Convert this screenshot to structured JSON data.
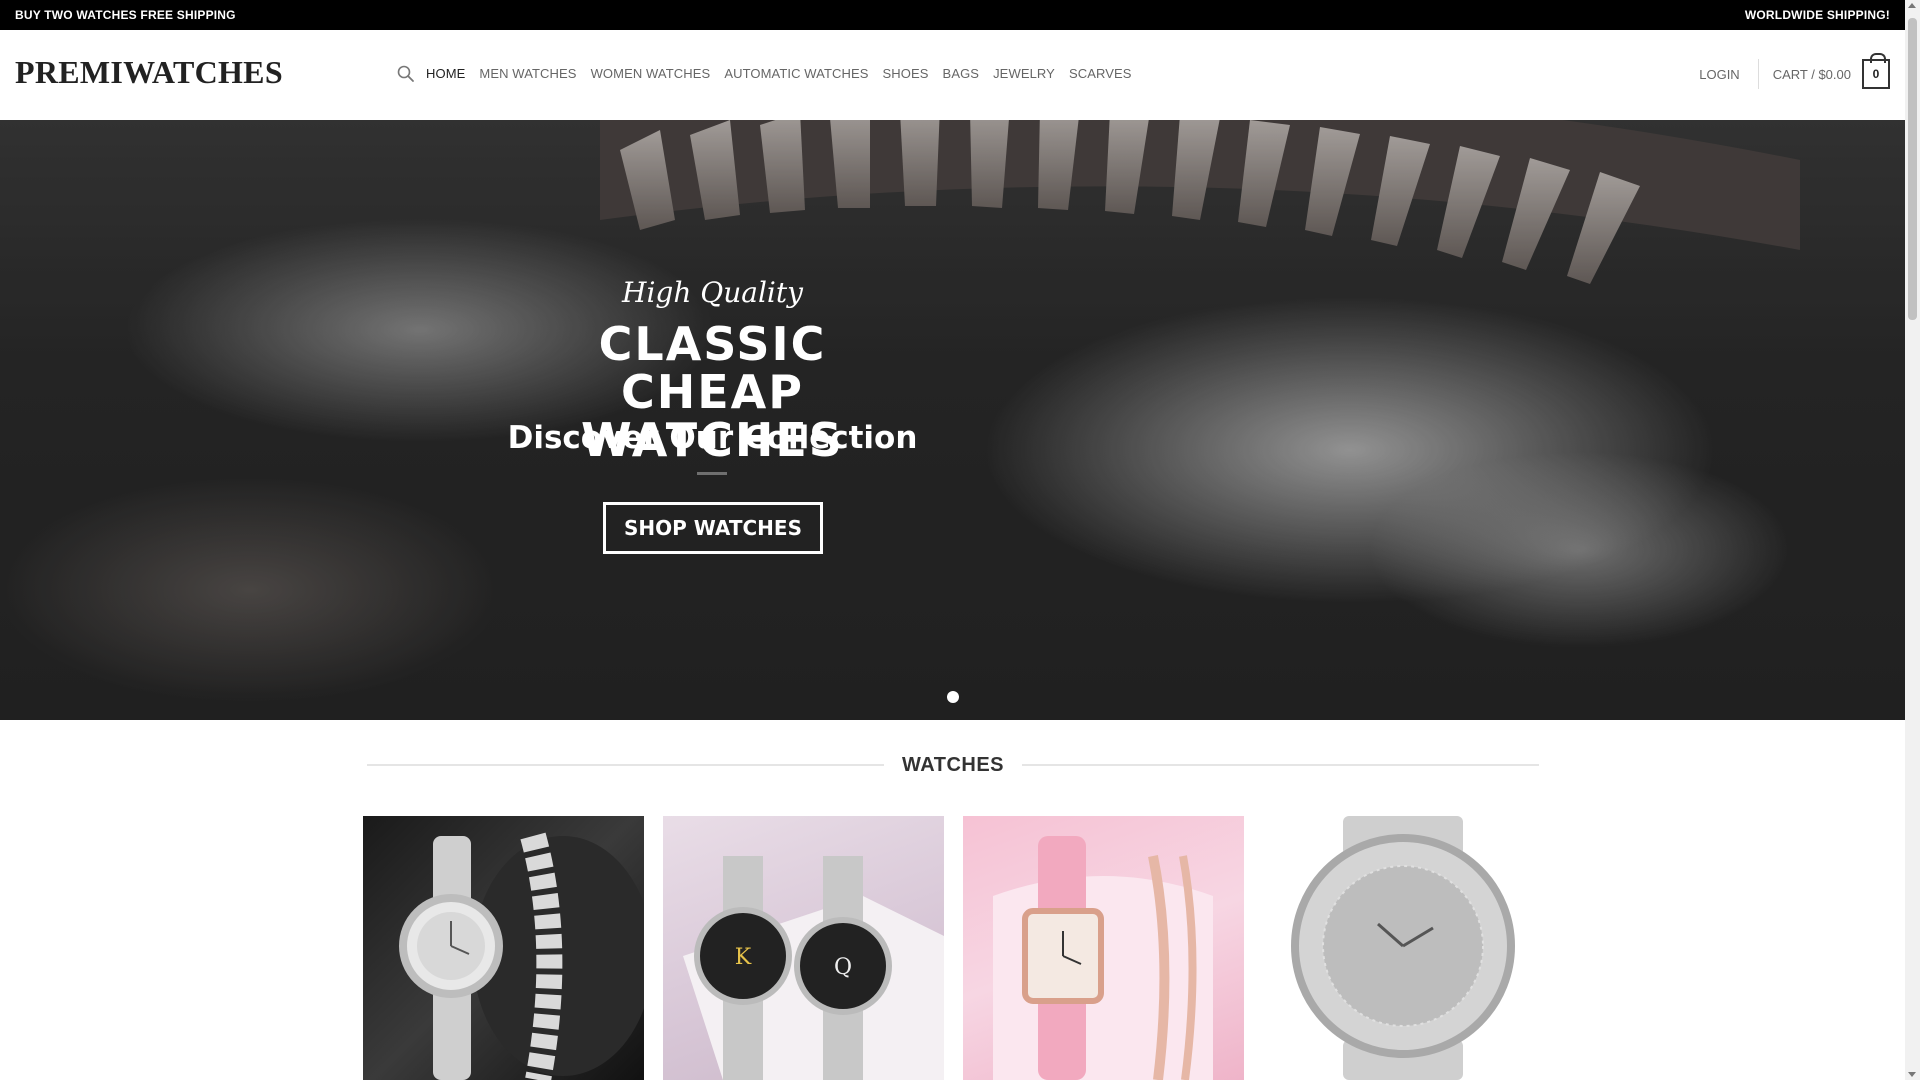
{
  "topbar": {
    "left_text": "BUY TWO WATCHES FREE SHIPPING",
    "right_text": "WORLDWIDE SHIPPING!"
  },
  "header": {
    "logo": "PREMIWATCHES",
    "nav": [
      {
        "label": "HOME"
      },
      {
        "label": "MEN WATCHES"
      },
      {
        "label": "WOMEN WATCHES"
      },
      {
        "label": "AUTOMATIC WATCHES"
      },
      {
        "label": "SHOES"
      },
      {
        "label": "BAGS"
      },
      {
        "label": "JEWELRY"
      },
      {
        "label": "SCARVES"
      }
    ],
    "login": "LOGIN",
    "cart_label": "CART / $0.00",
    "cart_count": "0"
  },
  "hero": {
    "kicker": "High Quality",
    "title": "CLASSIC CHEAP WATCHES",
    "subtitle": "Discover Our Collection",
    "button": "SHOP WATCHES"
  },
  "section": {
    "title": "WATCHES"
  },
  "products": [
    {
      "image": "silver crystal watch with chain bracelet"
    },
    {
      "image": "king and queen couple watches"
    },
    {
      "image": "pink leather square watch set"
    },
    {
      "image": "iced-out silver watch"
    }
  ],
  "colors": {
    "topbar_bg": "#000000",
    "text_dark": "#222222",
    "text_muted": "#666666"
  }
}
